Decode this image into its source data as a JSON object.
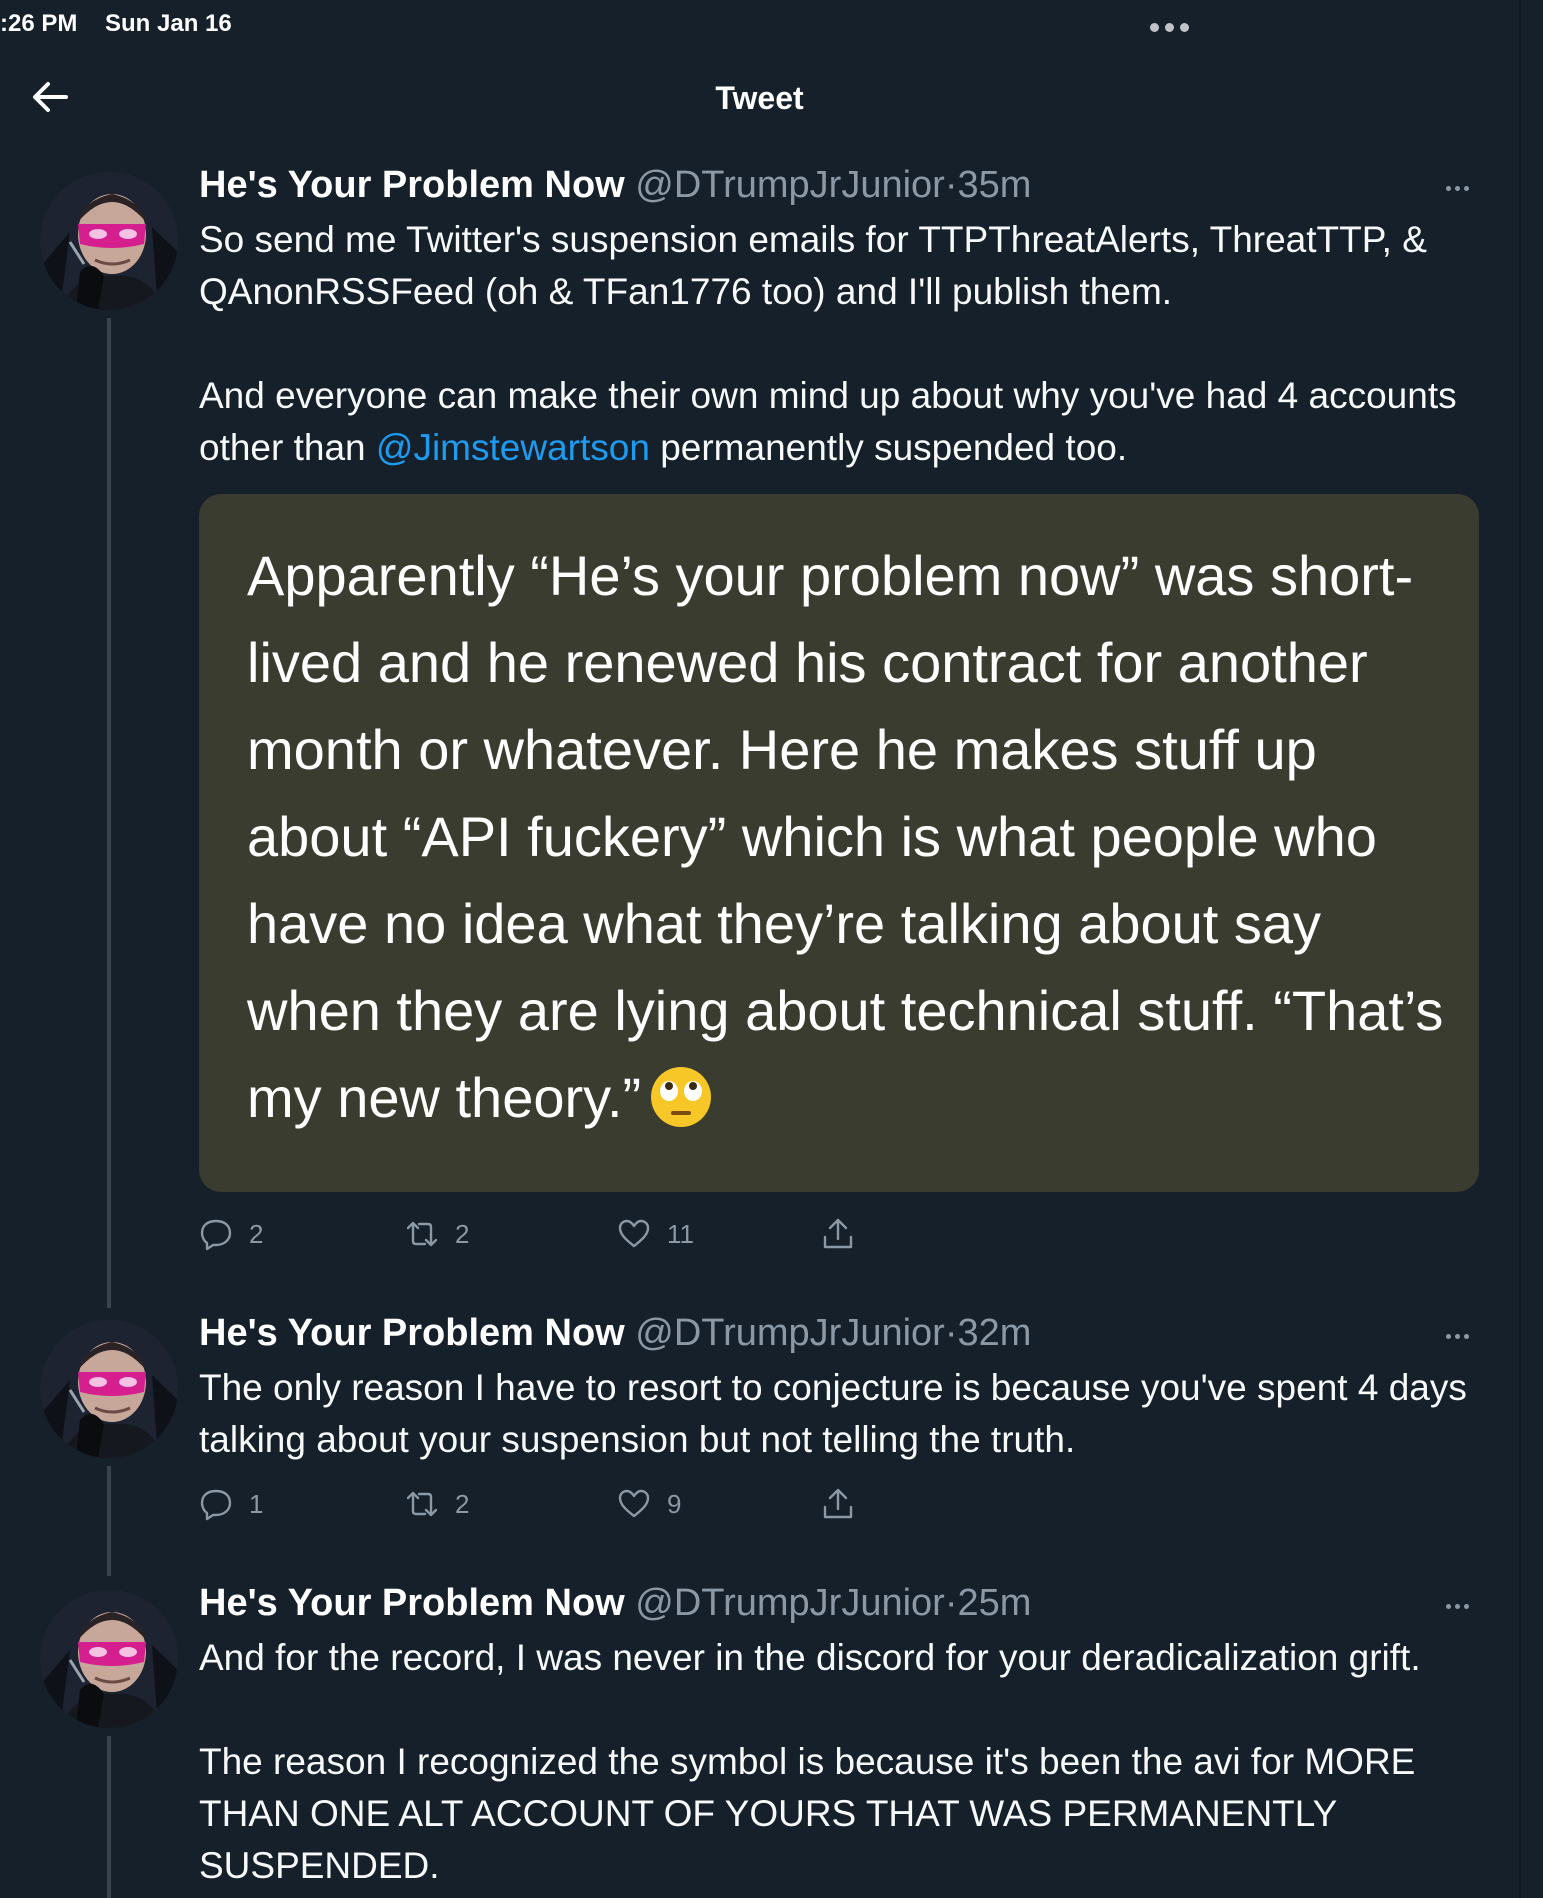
{
  "status_bar": {
    "time": ":26 PM",
    "date": "Sun Jan 16"
  },
  "header": {
    "title": "Tweet"
  },
  "tweets": [
    {
      "name": "He's Your Problem Now",
      "handle": "@DTrumpJrJunior",
      "sep": "·",
      "time": "35m",
      "text_p1": "So send me Twitter's suspension emails for TTPThreatAlerts, ThreatTTP, & QAnonRSSFeed (oh & TFan1776 too) and I'll publish them.",
      "text_p2_before": "And everyone can make their own mind up about why you've had 4 accounts other than ",
      "text_p2_mention": "@Jimstewartson",
      "text_p2_after": " permanently suspended too.",
      "quote_text": "Apparently “He’s your problem now” was short-lived and he renewed his contract for another month or whatever. Here he makes stuff up about “API fuckery” which is what people who have no idea what they’re talking about say when they are lying about technical stuff. “That’s my new theory.”",
      "quote_emoji": "face-with-rolling-eyes-emoji",
      "replies": "2",
      "retweets": "2",
      "likes": "11"
    },
    {
      "name": "He's Your Problem Now",
      "handle": "@DTrumpJrJunior",
      "sep": "·",
      "time": "32m",
      "text": "The only reason I have to resort to conjecture is because you've spent 4 days talking about your suspension but not telling the truth.",
      "replies": "1",
      "retweets": "2",
      "likes": "9"
    },
    {
      "name": "He's Your Problem Now",
      "handle": "@DTrumpJrJunior",
      "sep": "·",
      "time": "25m",
      "text_p1": "And for the record, I was never in the discord for your deradicalization grift.",
      "text_p2": "The reason I recognized the symbol is because it's been the avi for MORE THAN ONE ALT ACCOUNT OF YOURS THAT WAS PERMANENTLY SUSPENDED."
    }
  ],
  "colors": {
    "background": "#15202b",
    "mention": "#1d9bf0",
    "muted": "#8b98a5",
    "quote_bg": "#3b3c30",
    "mask": "#d61f8f"
  },
  "icons": [
    "back-arrow-icon",
    "more-icon",
    "reply-icon",
    "retweet-icon",
    "like-icon",
    "share-icon",
    "avatar-masked-man"
  ]
}
